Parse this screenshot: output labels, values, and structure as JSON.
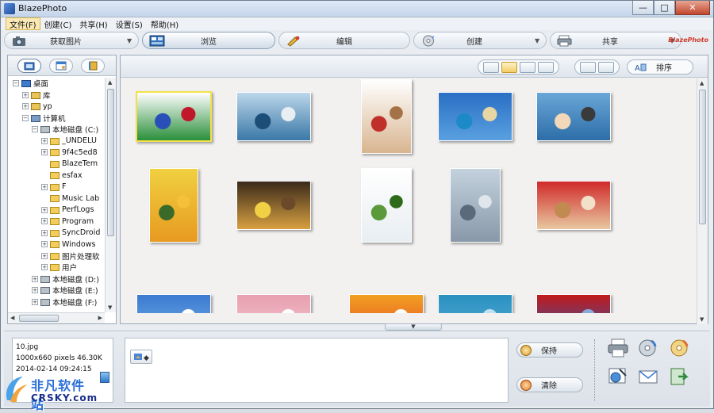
{
  "window": {
    "title": "BlazePhoto",
    "buttons": {
      "minimize": "—",
      "maximize": "□",
      "close": "✕"
    }
  },
  "menu": [
    "文件(F)",
    "创建(C)",
    "共享(H)",
    "设置(S)",
    "帮助(H)"
  ],
  "toolbar": {
    "acquire": "获取图片",
    "browse": "浏览",
    "edit": "编辑",
    "create": "创建",
    "share": "共享",
    "brand": "BlazePhoto"
  },
  "tree": [
    {
      "label": "桌面",
      "expander": "-",
      "level": 0,
      "icon": "desktop-icon"
    },
    {
      "label": "库",
      "expander": "+",
      "level": 1,
      "icon": "library-icon"
    },
    {
      "label": "yp",
      "expander": "+",
      "level": 1,
      "icon": "user-icon"
    },
    {
      "label": "计算机",
      "expander": "-",
      "level": 1,
      "icon": "computer-icon"
    },
    {
      "label": "本地磁盘 (C:)",
      "expander": "-",
      "level": 2,
      "icon": "drive-icon"
    },
    {
      "label": "_UNDELU",
      "expander": "+",
      "level": 3,
      "icon": "folder-icon"
    },
    {
      "label": "9f4c5ed8",
      "expander": "+",
      "level": 3,
      "icon": "folder-icon"
    },
    {
      "label": "BlazeTem",
      "expander": "",
      "level": 3,
      "icon": "folder-icon"
    },
    {
      "label": "esfax",
      "expander": "",
      "level": 3,
      "icon": "folder-icon"
    },
    {
      "label": "F",
      "expander": "+",
      "level": 3,
      "icon": "folder-icon"
    },
    {
      "label": "Music Lab",
      "expander": "",
      "level": 3,
      "icon": "folder-icon"
    },
    {
      "label": "PerfLogs",
      "expander": "+",
      "level": 3,
      "icon": "folder-icon"
    },
    {
      "label": "Program",
      "expander": "+",
      "level": 3,
      "icon": "folder-icon"
    },
    {
      "label": "SyncDroid",
      "expander": "+",
      "level": 3,
      "icon": "folder-icon"
    },
    {
      "label": "Windows",
      "expander": "+",
      "level": 3,
      "icon": "folder-icon"
    },
    {
      "label": "图片处理软",
      "expander": "+",
      "level": 3,
      "icon": "folder-icon"
    },
    {
      "label": "用户",
      "expander": "+",
      "level": 3,
      "icon": "folder-icon"
    },
    {
      "label": "本地磁盘 (D:)",
      "expander": "+",
      "level": 2,
      "icon": "drive-icon"
    },
    {
      "label": "本地磁盘 (E:)",
      "expander": "+",
      "level": 2,
      "icon": "drive-icon"
    },
    {
      "label": "本地磁盘 (F:)",
      "expander": "+",
      "level": 2,
      "icon": "drive-icon"
    }
  ],
  "sort_label": "排序",
  "thumbnails": [
    {
      "name": "dice",
      "colors": [
        "#ffffff",
        "#2a8f3a",
        "#2a4fb8",
        "#c0182a"
      ]
    },
    {
      "name": "sailboat-sea",
      "colors": [
        "#bcd7ea",
        "#3a78a8",
        "#1d4e78",
        "#e8eef2"
      ]
    },
    {
      "name": "child-santa-hat",
      "colors": [
        "#ffffff",
        "#d8b58f",
        "#c0302a",
        "#a47246"
      ]
    },
    {
      "name": "tropical-island",
      "colors": [
        "#2a6fc4",
        "#5aa0e0",
        "#1c8ac8",
        "#e8d7a4"
      ]
    },
    {
      "name": "beach-chairs",
      "colors": [
        "#6aa7d8",
        "#2d6ea8",
        "#f2d8b8",
        "#3a3a3a"
      ]
    },
    {
      "name": "boy-balloons",
      "colors": [
        "#f0d040",
        "#e89a20",
        "#3a6a2a",
        "#f6c03a"
      ]
    },
    {
      "name": "girl-sunflower-hat",
      "colors": [
        "#3a2a1a",
        "#d8a040",
        "#f2d046",
        "#6a4a2a"
      ]
    },
    {
      "name": "green-hill-tree",
      "colors": [
        "#ffffff",
        "#e8eef2",
        "#5a9a3a",
        "#2d6a1a"
      ]
    },
    {
      "name": "city-towers",
      "colors": [
        "#c4d2de",
        "#8898a8",
        "#5a6a7a",
        "#e0e6ec"
      ]
    },
    {
      "name": "teddy-bears",
      "colors": [
        "#d02a2a",
        "#e8c8a0",
        "#c08a50",
        "#f2e0c8"
      ]
    },
    {
      "name": "blue-sky",
      "colors": [
        "#3a7ad0",
        "#7ab0e8",
        "#b8d8f4",
        "#ffffff"
      ]
    },
    {
      "name": "flowers",
      "colors": [
        "#e8a0b0",
        "#f4c8d0",
        "#c05070",
        "#ffffff"
      ]
    },
    {
      "name": "fruits",
      "colors": [
        "#f0a020",
        "#e84a2a",
        "#f8d878",
        "#ffffff"
      ]
    },
    {
      "name": "pool-aerial",
      "colors": [
        "#2a90c0",
        "#5ab0d8",
        "#8a6a3a",
        "#c0e0f0"
      ]
    },
    {
      "name": "red-leaves",
      "colors": [
        "#c01a1a",
        "#2a5ab8",
        "#e84a3a",
        "#8aa8d8"
      ]
    }
  ],
  "file_info": {
    "filename": "10.jpg",
    "dimensions": "1000x660 pixels",
    "size": "46.30K",
    "date": "2014-02-14 09:24:15"
  },
  "actions": {
    "keep": "保持",
    "clear": "清除"
  },
  "watermark": {
    "text": "非凡软件站",
    "sub": "CRSKY.com"
  }
}
